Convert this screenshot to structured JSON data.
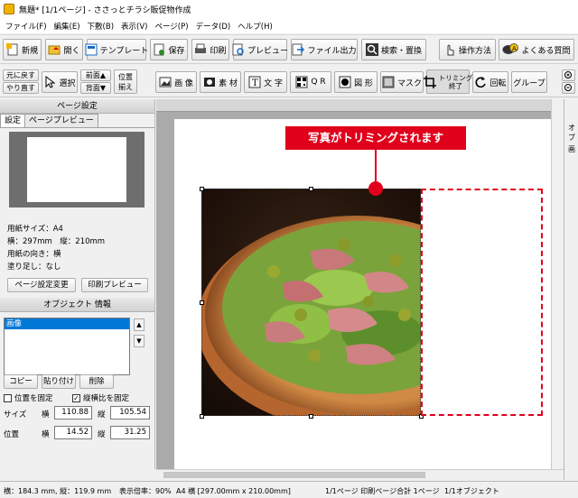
{
  "window": {
    "title": "無題* [1/1ページ] - ささっとチラシ販促物作成"
  },
  "menu": [
    "ファイル(F)",
    "編集(E)",
    "下敷(B)",
    "表示(V)",
    "ページ(P)",
    "データ(D)",
    "ヘルプ(H)"
  ],
  "toolbar1": {
    "new": "新規",
    "open": "開く",
    "template": "テンプレート",
    "save": "保存",
    "print": "印刷",
    "preview": "プレビュー",
    "file_output": "ファイル出力",
    "search_replace": "検索・置換",
    "how_to": "操作方法",
    "faq": "よくある質問"
  },
  "toolbar2": {
    "undo": "元に戻す",
    "redo": "やり直す",
    "select": "選択",
    "front": "前面▲",
    "back": "背面▼",
    "align_1": "位置",
    "align_2": "揃え",
    "image": "画 像",
    "material": "素 材",
    "text": "文 字",
    "qr": "Q R",
    "shape": "図 形",
    "mask": "マスク",
    "trim_1": "トリミング",
    "trim_2": "終了",
    "rotate": "回転",
    "group": "グループ"
  },
  "page_settings": {
    "header": "ページ設定",
    "tab_settings": "設定",
    "tab_preview": "ページプレビュー",
    "paper_size": "用紙サイズ：A4",
    "dimensions": "横：297mm　縦：210mm",
    "orientation": "用紙の向き：横",
    "bleed": "塗り足し：なし",
    "change_btn": "ページ設定変更",
    "print_preview_btn": "印刷プレビュー"
  },
  "object_info": {
    "header": "オブジェクト 情報",
    "list": [
      "画像"
    ],
    "copy": "コピー",
    "paste": "貼り付け",
    "delete": "削除",
    "fix_position": "位置を固定",
    "fix_ratio": "縦横比を固定",
    "size_label": "サイズ",
    "pos_label": "位置",
    "w_label": "横",
    "h_label": "縦",
    "size_w": "110.88",
    "size_h": "105.54",
    "pos_x": "14.52",
    "pos_y": "31.25"
  },
  "callout": "写真がトリミングされます",
  "status": {
    "dims": "横：184.3 mm, 縦：119.9 mm",
    "zoom": "表示倍率：90%",
    "paper": "A4 横 [297.00mm x 210.00mm]",
    "pages": "1/1ページ 印刷ページ合計 1ページ",
    "objects": "1/1オブジェクト"
  },
  "right_panel": {
    "tab_1": "オブ",
    "tab_2": "画"
  },
  "colors": {
    "accent_red": "#e0001b",
    "selection_blue": "#0078d7"
  }
}
